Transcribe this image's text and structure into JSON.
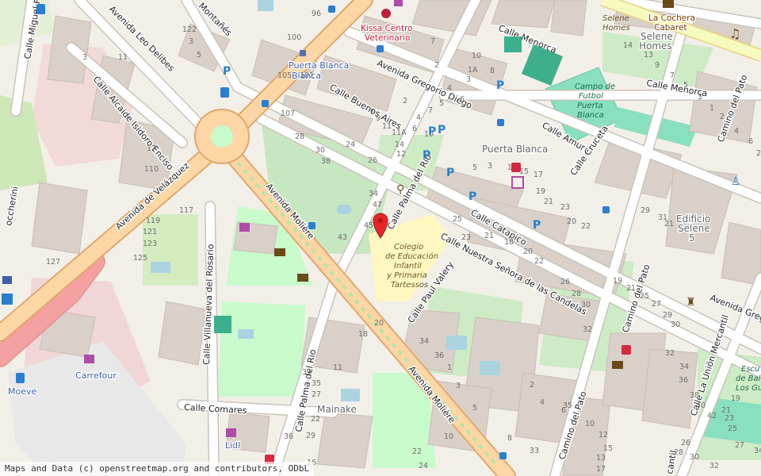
{
  "map": {
    "streets": {
      "miguel_fleta": "Calle Miguel Fleta",
      "leo_delibes": "Avenida Leo Delibes",
      "alcaide": "Calle Alcaide Isidoro Enciso",
      "velazquez": "Avenida de Velázquez",
      "montanes": "Montañés",
      "buenos_aires": "Calle Buenos Aires",
      "gregorio_diego": "Avenida Gregorio Diego",
      "menorca_top": "Calle Menorca",
      "menorca_right": "Calle Menorca",
      "amura": "Calle Amura",
      "cruceta": "Calle Cruceta",
      "palma_rio_north": "Calle Palma del Rio",
      "palma_rio_south": "Calle Palma del Rio",
      "catapico": "Calle Catapico",
      "nuestra_senora": "Calle Nuestra Señora de las Candelas",
      "paul_valery": "Calle Paul Valery",
      "moliere_north": "Avenida Molière",
      "moliere_south": "Avenida Molière",
      "villanueva": "Calle Villanueva del Rosario",
      "comares": "Calle Comares",
      "camino_pato_north": "Camino del Pato",
      "camino_pato_mid": "Camino del Pato",
      "camino_pato_south": "Camino del Pato",
      "union_mercantil": "Calle La Unión Mercantil",
      "gregorio_right": "Avenida Grego",
      "cantil": "cantil",
      "rocchierini": "occherini",
      "menorca_mid": "Menorca"
    },
    "places": {
      "puerta_blanca_stop": "Puerta Blanca",
      "puerta_blanca_district": "Puerta Blanca",
      "kissa_line1": "Kissa Centro",
      "kissa_line2": "Veterinario",
      "campo_line1": "Campo de",
      "campo_line2": "Futbol",
      "campo_line3": "Puerta",
      "campo_line4": "Blanca",
      "selene_homes_label_1": "Selene",
      "selene_homes_label_2": "Homes",
      "selene_homes_big_1": "Selene",
      "selene_homes_big_2": "Homes",
      "cochera_1": "La Cochera",
      "cochera_2": "Cabaret",
      "edificio_1": "Edificio",
      "edificio_2": "Selene",
      "edificio_3": "5",
      "colegio_1": "Colegio",
      "colegio_2": "de Educación",
      "colegio_3": "Infantil",
      "colegio_4": "y Primaria",
      "colegio_5": "Tartessos",
      "carrefour": "Carrefour",
      "moeve": "Moeve",
      "lidl": "Lidl",
      "mainake": "Mainake",
      "escuela_1": "Escu",
      "escuela_2": "de Balo",
      "escuela_3": "Los Guin"
    },
    "house_numbers": [
      "96",
      "100",
      "101",
      "105",
      "107",
      "3",
      "11",
      "17",
      "110",
      "117",
      "119",
      "121",
      "123",
      "125",
      "127",
      "122",
      "3",
      "5",
      "7",
      "2",
      "4",
      "6",
      "8",
      "10",
      "1A",
      "3",
      "5",
      "7",
      "2",
      "4",
      "6",
      "10",
      "12",
      "14",
      "11A",
      "11",
      "9",
      "7",
      "5",
      "3",
      "1",
      "15",
      "17",
      "19",
      "21",
      "23",
      "20",
      "22",
      "24",
      "26",
      "28",
      "30",
      "38",
      "34",
      "47",
      "45",
      "43",
      "39",
      "35",
      "27",
      "22",
      "11",
      "25",
      "23",
      "21",
      "18",
      "20",
      "22",
      "26",
      "28",
      "30",
      "32",
      "34",
      "36",
      "1",
      "3",
      "5",
      "2",
      "4",
      "6",
      "10",
      "12",
      "15",
      "13",
      "17",
      "19",
      "21",
      "25",
      "27",
      "29",
      "30",
      "32",
      "34",
      "36",
      "38",
      "40",
      "42",
      "19",
      "21",
      "23",
      "25",
      "27",
      "29",
      "36",
      "16",
      "18",
      "20",
      "22",
      "24",
      "10",
      "8",
      "33",
      "35",
      "29",
      "31",
      "21",
      "14",
      "13",
      "9",
      "7",
      "5",
      "3",
      "1",
      "2",
      "4",
      "6",
      "24",
      "26",
      "28",
      "30",
      "32",
      "34",
      "36",
      "38",
      "22",
      "20",
      "19A",
      "19",
      "2"
    ],
    "colors": {
      "background": "#f2efe9",
      "primary_road": "#fcd6a4",
      "trunk_road": "#f5a1a1",
      "park": "#c8facc",
      "pitch": "#88e0be",
      "school": "#fff7c0",
      "building": "#d9d0c9",
      "parking": "#eeeeee",
      "commercial": "#f2dad9",
      "icon_blue": "#2a7fd0",
      "marker_red": "#e8262a"
    },
    "marker": "location-pin-icon"
  },
  "attribution": "Maps and Data (c) openstreetmap.org and contributors, ODbL"
}
